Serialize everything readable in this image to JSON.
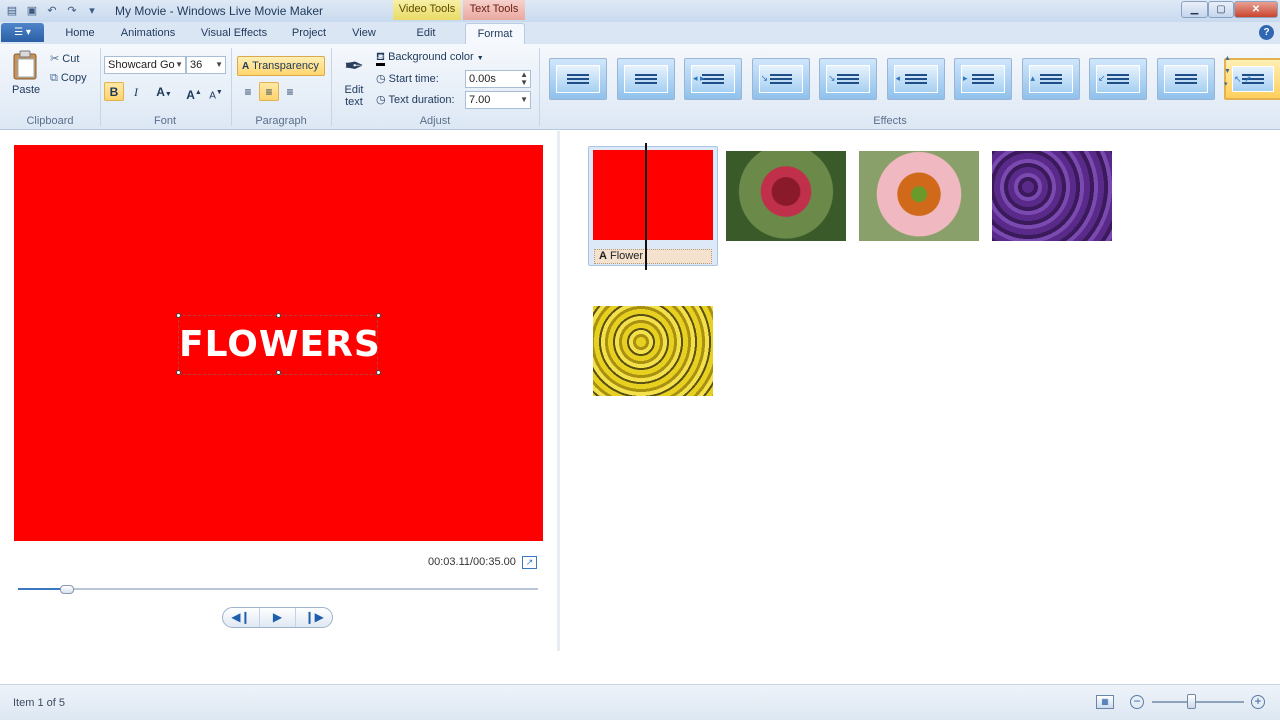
{
  "window": {
    "title": "My Movie - Windows Live Movie Maker",
    "context_tabs": [
      "Video Tools",
      "Text Tools"
    ]
  },
  "tabs": [
    {
      "label": "Home"
    },
    {
      "label": "Animations"
    },
    {
      "label": "Visual Effects"
    },
    {
      "label": "Project"
    },
    {
      "label": "View"
    },
    {
      "label": "Edit"
    },
    {
      "label": "Format",
      "active": true
    }
  ],
  "ribbon": {
    "clipboard": {
      "label": "Clipboard",
      "paste": "Paste",
      "cut": "Cut",
      "copy": "Copy"
    },
    "font": {
      "label": "Font",
      "family": "Showcard Go",
      "size": "36",
      "bold": "B",
      "italic": "I",
      "color": "A",
      "grow": "A",
      "shrink": "A"
    },
    "paragraph": {
      "label": "Paragraph",
      "transparency": "Transparency"
    },
    "adjust": {
      "label": "Adjust",
      "edit_text": "Edit text",
      "background_color": "Background color",
      "start_time_label": "Start time:",
      "start_time_value": "0.00s",
      "duration_label": "Text duration:",
      "duration_value": "7.00"
    },
    "effects": {
      "label": "Effects",
      "count": 11,
      "selected_index": 10
    }
  },
  "preview": {
    "background": "#ff0000",
    "text": "FLOWERS",
    "time": "00:03.11/00:35.00",
    "seek_fraction": 0.09
  },
  "storyboard": {
    "title_clip_caption": "Flower",
    "clips": [
      "title-card",
      "red-dahlia",
      "orange-coneflower",
      "purple-flowers",
      "yellow-flowers"
    ]
  },
  "status": {
    "text": "Item 1 of 5",
    "zoom_fraction": 0.42
  },
  "colors": {
    "accent": "#2a5ea6",
    "ribbon_bg": "#dde8f5",
    "highlight": "#ffd36c"
  }
}
